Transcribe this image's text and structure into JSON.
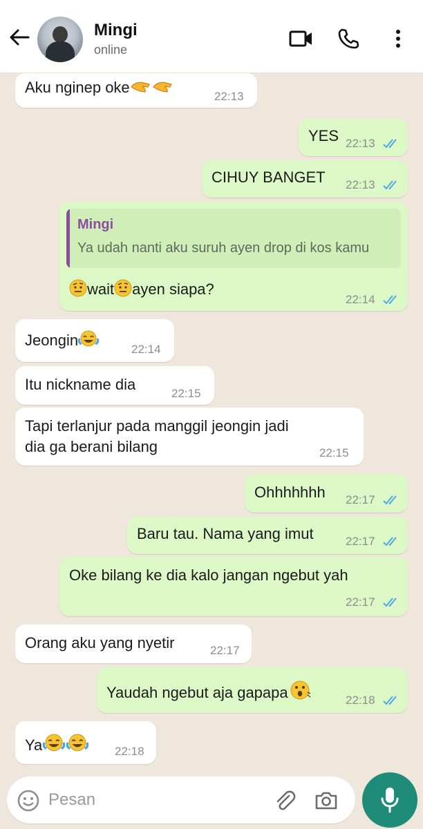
{
  "header": {
    "contact_name": "Mingi",
    "status": "online",
    "icons": [
      "back-arrow-icon",
      "video-call-icon",
      "phone-icon",
      "more-vert-icon"
    ]
  },
  "messages": [
    {
      "dir": "in",
      "text": "Aku nginep oke",
      "emoji": [
        "pinching-hand",
        "pinching-hand"
      ],
      "time": "22:13"
    },
    {
      "dir": "out",
      "text": "YES",
      "time": "22:13",
      "read": true
    },
    {
      "dir": "out",
      "text": "CIHUY BANGET",
      "time": "22:13",
      "read": true
    },
    {
      "dir": "out",
      "quote": {
        "name": "Mingi",
        "text": "Ya udah nanti aku suruh ayen drop di kos kamu"
      },
      "text_a": "wait",
      "text_b": "ayen siapa?",
      "emoji": [
        "raised-eyebrow",
        "raised-eyebrow"
      ],
      "time": "22:14",
      "read": true
    },
    {
      "dir": "in",
      "text": "Jeongin",
      "emoji": [
        "tears-of-joy"
      ],
      "time": "22:14"
    },
    {
      "dir": "in",
      "text": "Itu nickname dia",
      "time": "22:15"
    },
    {
      "dir": "in",
      "line1": "Tapi terlanjur pada manggil jeongin jadi",
      "line2": "dia ga berani bilang",
      "time": "22:15"
    },
    {
      "dir": "out",
      "text": "Ohhhhhhh",
      "time": "22:17",
      "read": true
    },
    {
      "dir": "out",
      "text": "Baru tau. Nama yang imut",
      "time": "22:17",
      "read": true
    },
    {
      "dir": "out",
      "text": "Oke bilang ke dia kalo jangan ngebut yah",
      "time": "22:17",
      "read": true
    },
    {
      "dir": "in",
      "text": "Orang aku yang nyetir",
      "time": "22:17"
    },
    {
      "dir": "out",
      "text": "Yaudah ngebut aja gapapa",
      "emoji": [
        "hushed-face"
      ],
      "time": "22:18",
      "read": true
    },
    {
      "dir": "in",
      "text": "Ya",
      "emoji": [
        "tears-of-joy",
        "tears-of-joy"
      ],
      "time": "22:18"
    }
  ],
  "composer": {
    "placeholder": "Pesan",
    "icons": [
      "emoji-icon",
      "attach-icon",
      "camera-icon",
      "mic-icon"
    ]
  },
  "colors": {
    "outgoing_bubble": "#dcf8c6",
    "incoming_bubble": "#ffffff",
    "read_ticks": "#4fa8e8",
    "quote_accent": "#8b4ea0",
    "mic_button": "#1f8c7a"
  }
}
